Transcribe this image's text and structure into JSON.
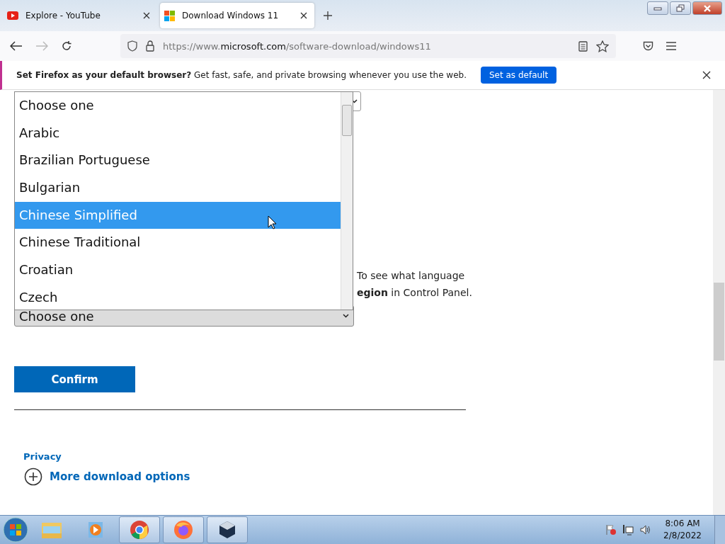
{
  "tabs": [
    {
      "title": "Explore - YouTube",
      "kind": "youtube",
      "selected": false
    },
    {
      "title": "Download Windows 11",
      "kind": "windows",
      "selected": true
    }
  ],
  "address": {
    "prefix": "https://www.",
    "domain": "microsoft.com",
    "path": "/software-download/windows11"
  },
  "notification": {
    "text": "**Set Firefox as your default browser?** Get fast, safe, and private browsing whenever you use the web.",
    "button": "Set as default"
  },
  "dropdown": {
    "options": [
      {
        "label": "Choose one",
        "selected": false
      },
      {
        "label": "Arabic",
        "selected": false
      },
      {
        "label": "Brazilian Portuguese",
        "selected": false
      },
      {
        "label": "Bulgarian",
        "selected": false
      },
      {
        "label": "Chinese Simplified",
        "selected": true
      },
      {
        "label": "Chinese Traditional",
        "selected": false
      },
      {
        "label": "Croatian",
        "selected": false
      },
      {
        "label": "Czech",
        "selected": false
      }
    ]
  },
  "paragraph_lines": [
    "To see what language",
    "**egion** in Control Panel."
  ],
  "select": {
    "value": "Choose one"
  },
  "confirm_button": "Confirm",
  "privacy_link": "Privacy",
  "more_options_link": "More download options",
  "taskbar": {
    "apps": [
      {
        "kind": "explorer",
        "running": false
      },
      {
        "kind": "media",
        "running": false
      },
      {
        "kind": "chrome",
        "running": true
      },
      {
        "kind": "firefox",
        "running": true
      },
      {
        "kind": "virtualbox",
        "running": true
      }
    ],
    "time": "8:06 AM",
    "date": "2/8/2022"
  }
}
